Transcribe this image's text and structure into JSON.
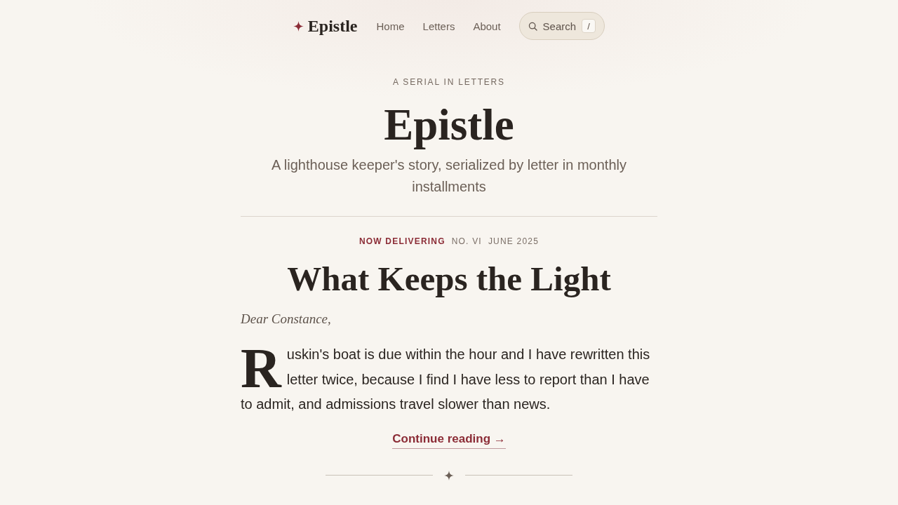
{
  "nav": {
    "brand": "Epistle",
    "links": [
      {
        "label": "Home"
      },
      {
        "label": "Letters"
      },
      {
        "label": "About"
      }
    ],
    "search": {
      "label": "Search",
      "shortcut": "/"
    }
  },
  "hero": {
    "eyebrow": "A SERIAL IN LETTERS",
    "title": "Epistle",
    "subtitle": "A lighthouse keeper's story, serialized by letter in monthly installments"
  },
  "featured": {
    "status": "NOW DELIVERING",
    "number": "NO. VI",
    "date": "JUNE 2025",
    "title": "What Keeps the Light",
    "salutation": "Dear Constance,",
    "drop_cap": "R",
    "excerpt": "uskin's boat is due within the hour and I have rewritten this letter twice, because I find I have less to report than I have to admit, and admissions travel slower than news.",
    "link": "Continue reading →"
  }
}
